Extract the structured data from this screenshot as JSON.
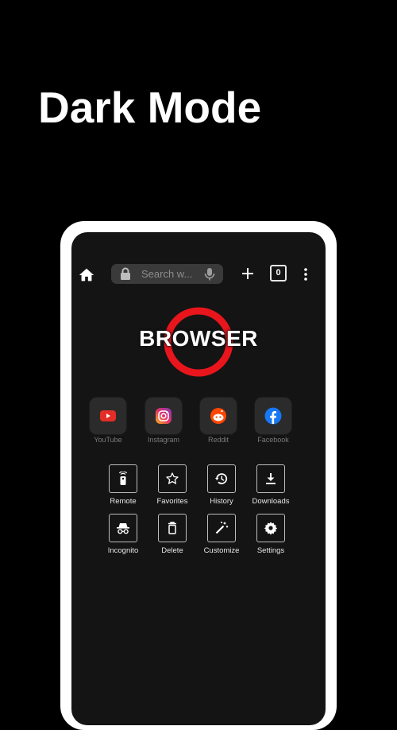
{
  "headline": "Dark Mode",
  "toolbar": {
    "search_placeholder": "Search w...",
    "tab_count": "0",
    "icons": [
      "home-icon",
      "lock-icon",
      "microphone-icon",
      "plus-icon",
      "tab-counter",
      "more-vert-icon"
    ]
  },
  "logo": {
    "text": "BROWSER",
    "ring_color": "#e8161c"
  },
  "shortcuts": [
    {
      "label": "YouTube",
      "icon": "youtube-icon",
      "color": "#e52d27"
    },
    {
      "label": "Instagram",
      "icon": "instagram-icon",
      "color": "#d6249f"
    },
    {
      "label": "Reddit",
      "icon": "reddit-icon",
      "color": "#ff4500"
    },
    {
      "label": "Facebook",
      "icon": "facebook-icon",
      "color": "#1877f2"
    }
  ],
  "tools": [
    {
      "label": "Remote",
      "icon": "remote-icon"
    },
    {
      "label": "Favorites",
      "icon": "star-icon"
    },
    {
      "label": "History",
      "icon": "history-icon"
    },
    {
      "label": "Downloads",
      "icon": "download-icon"
    },
    {
      "label": "Incognito",
      "icon": "incognito-icon"
    },
    {
      "label": "Delete",
      "icon": "trash-icon"
    },
    {
      "label": "Customize",
      "icon": "magic-wand-icon"
    },
    {
      "label": "Settings",
      "icon": "gear-icon"
    }
  ]
}
